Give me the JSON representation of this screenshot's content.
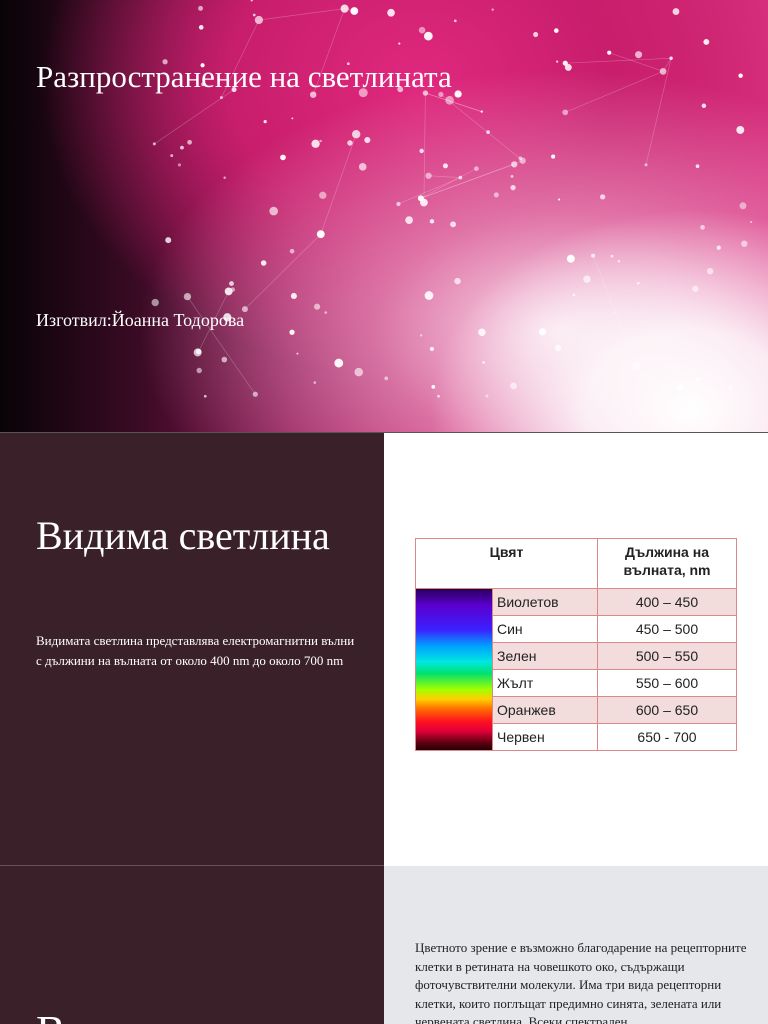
{
  "slide1": {
    "title": "Разпространение на светлината",
    "author": "Изготвил:Йоанна Тодорова"
  },
  "slide2": {
    "title": "Видима светлина",
    "text": "Видимата светлина представлява електромагнитни вълни с дължини на вълната от около 400 nm  до около 700 nm",
    "table": {
      "headers": [
        "Цвят",
        "Дължина на вълната, nm"
      ],
      "rows": [
        {
          "color": "Виолетов",
          "range": "400 – 450"
        },
        {
          "color": "Син",
          "range": "450 – 500"
        },
        {
          "color": "Зелен",
          "range": "500 – 550"
        },
        {
          "color": "Жълт",
          "range": "550 – 600"
        },
        {
          "color": "Оранжев",
          "range": "600 – 650"
        },
        {
          "color": "Червен",
          "range": "650 - 700"
        }
      ]
    }
  },
  "slide3": {
    "heading": "В",
    "text": "Цветното зрение е възможно благодарение на рецепторните  клетки в ретината на човешкото око, съдържащи фоточувствителни молекули. Има три вида рецепторни клетки, които поглъщат  предимно синята, зелената  или  червената светлина. Всеки спектрален"
  }
}
